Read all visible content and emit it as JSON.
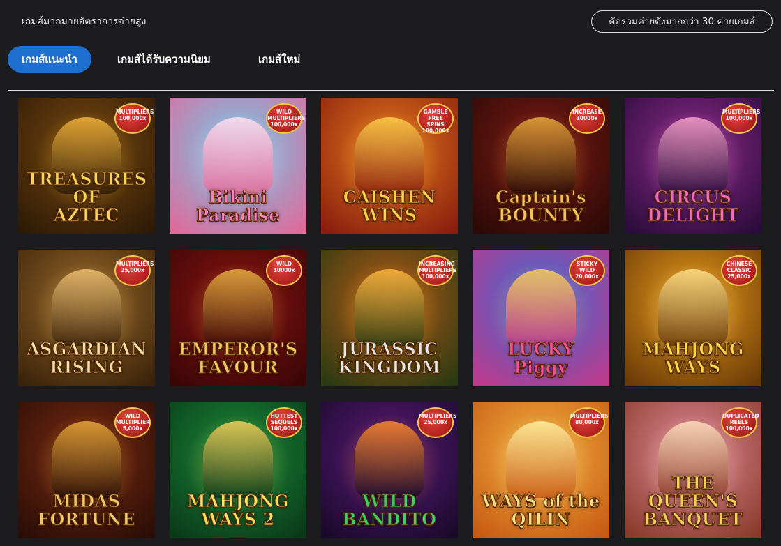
{
  "header": {
    "tagline": "เกมส์มากมายอัตราการจ่ายสูง",
    "filter_pill": "คัดรวมค่ายดังมากกว่า 30 ค่ายเกมส์"
  },
  "tabs": [
    {
      "label": "เกมส์แนะนำ",
      "active": true
    },
    {
      "label": "เกมส์ได้รับความนิยม",
      "active": false
    },
    {
      "label": "เกมส์ใหม่",
      "active": false
    }
  ],
  "games": [
    {
      "title": "TREASURES OF\nAZTEC",
      "badge": "MULTIPLIERS\n100,000x",
      "bg": "#7a4a10",
      "bg2": "#2d1a06",
      "accent": "#f2b33a",
      "title_color": "#f7d35a"
    },
    {
      "title": "Bikini\nParadise",
      "badge": "WILD\nMULTIPLIERS\n100,000x",
      "bg": "#6fc7e8",
      "bg2": "#e06a9a",
      "accent": "#ffe0f0",
      "title_color": "#ff7fc4"
    },
    {
      "title": "CAISHEN\nWINS",
      "badge": "GAMBLE\nFREE SPINS\n100,000x",
      "bg": "#e37a1d",
      "bg2": "#8a1d0e",
      "accent": "#ffcf4a",
      "title_color": "#ffd347"
    },
    {
      "title": "Captain's\nBOUNTY",
      "badge": "INCREASE\n30000x",
      "bg": "#7e1a14",
      "bg2": "#2a0a06",
      "accent": "#e8a63a",
      "title_color": "#f4c15a"
    },
    {
      "title": "CIRCUS\nDELIGHT",
      "badge": "MULTIPLIERS\n100,000x",
      "bg": "#8e2a8c",
      "bg2": "#2a0c3a",
      "accent": "#f5a0c8",
      "title_color": "#f06ac0"
    },
    {
      "title": "ASGARDIAN\nRISING",
      "badge": "MULTIPLIERS\n25,000x",
      "bg": "#9a6a2a",
      "bg2": "#3a230a",
      "accent": "#f0c070",
      "title_color": "#f5dfa8"
    },
    {
      "title": "EMPEROR'S\nFAVOUR",
      "badge": "WILD\n10000x",
      "bg": "#8a1412",
      "bg2": "#3a0606",
      "accent": "#e8b040",
      "title_color": "#f0c860"
    },
    {
      "title": "JURASSIC\nKINGDOM",
      "badge": "INCREASING\nMULTIPLIERS\n100,000x",
      "bg": "#b55a16",
      "bg2": "#2a3a12",
      "accent": "#ffb840",
      "title_color": "#e8e8e8"
    },
    {
      "title": "LUCKY\nPiggy",
      "badge": "STICKY\nWILD\n20,000x",
      "bg": "#3a6ad8",
      "bg2": "#c03a8a",
      "accent": "#f7d05a",
      "title_color": "#ff4f9a"
    },
    {
      "title": "MAHJONG\nWAYS",
      "badge": "CHINESE\nCLASSIC\n25,000x",
      "bg": "#e89a1a",
      "bg2": "#6a3a08",
      "accent": "#ffe08a",
      "title_color": "#ffd845"
    },
    {
      "title": "MIDAS\nFORTUNE",
      "badge": "WILD\nMULTIPLIER\n5,000x",
      "bg": "#7a2a12",
      "bg2": "#2a0e06",
      "accent": "#e8a83a",
      "title_color": "#f0c868"
    },
    {
      "title": "MAHJONG\nWAYS 2",
      "badge": "HOTTEST\nSEQUELS\n100,000x",
      "bg": "#1a8a3a",
      "bg2": "#0a3a18",
      "accent": "#f7d05a",
      "title_color": "#ffe060"
    },
    {
      "title": "WILD\nBANDITO",
      "badge": "MULTIPLIERS\n25,000x",
      "bg": "#5a1a7a",
      "bg2": "#1a0a2a",
      "accent": "#ff8a2a",
      "title_color": "#3ad06a"
    },
    {
      "title": "WAYS of the\nQILIN",
      "badge": "MULTIPLIERS\n80,000x",
      "bg": "#f0b040",
      "bg2": "#c85a12",
      "accent": "#fff0a0",
      "title_color": "#f8e080"
    },
    {
      "title": "THE QUEEN'S\nBANQUET",
      "badge": "DUPLICATED\nREELS\n100,000x",
      "bg": "#e08a9a",
      "bg2": "#8a3a2a",
      "accent": "#ffe0c0",
      "title_color": "#f5d058"
    }
  ]
}
